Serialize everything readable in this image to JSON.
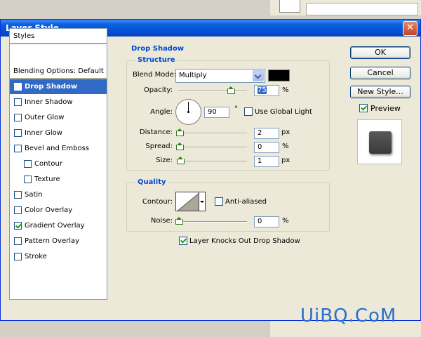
{
  "window": {
    "title": "Layer Style",
    "close_glyph": "✕"
  },
  "styles_list": {
    "header": "Styles",
    "items": [
      {
        "label": "Blending Options: Default",
        "checkbox": false,
        "checked": false,
        "selected": false,
        "indent": 0
      },
      {
        "label": "Drop Shadow",
        "checkbox": true,
        "checked": true,
        "selected": true,
        "indent": 0
      },
      {
        "label": "Inner Shadow",
        "checkbox": true,
        "checked": false,
        "selected": false,
        "indent": 0
      },
      {
        "label": "Outer Glow",
        "checkbox": true,
        "checked": false,
        "selected": false,
        "indent": 0
      },
      {
        "label": "Inner Glow",
        "checkbox": true,
        "checked": false,
        "selected": false,
        "indent": 0
      },
      {
        "label": "Bevel and Emboss",
        "checkbox": true,
        "checked": false,
        "selected": false,
        "indent": 0
      },
      {
        "label": "Contour",
        "checkbox": true,
        "checked": false,
        "selected": false,
        "indent": 1
      },
      {
        "label": "Texture",
        "checkbox": true,
        "checked": false,
        "selected": false,
        "indent": 1
      },
      {
        "label": "Satin",
        "checkbox": true,
        "checked": false,
        "selected": false,
        "indent": 0
      },
      {
        "label": "Color Overlay",
        "checkbox": true,
        "checked": false,
        "selected": false,
        "indent": 0
      },
      {
        "label": "Gradient Overlay",
        "checkbox": true,
        "checked": true,
        "selected": false,
        "indent": 0
      },
      {
        "label": "Pattern Overlay",
        "checkbox": true,
        "checked": false,
        "selected": false,
        "indent": 0
      },
      {
        "label": "Stroke",
        "checkbox": true,
        "checked": false,
        "selected": false,
        "indent": 0
      }
    ]
  },
  "drop_shadow": {
    "title": "Drop Shadow",
    "structure": {
      "title": "Structure",
      "blend_mode_label": "Blend Mode:",
      "blend_mode_value": "Multiply",
      "shadow_color": "#000000",
      "opacity_label": "Opacity:",
      "opacity_value": "75",
      "opacity_fraction": 0.75,
      "opacity_unit": "%",
      "angle_label": "Angle:",
      "angle_value": "90",
      "angle_unit": "°",
      "global_light_label": "Use Global Light",
      "global_light_checked": false,
      "distance_label": "Distance:",
      "distance_value": "2",
      "distance_unit": "px",
      "spread_label": "Spread:",
      "spread_value": "0",
      "spread_unit": "%",
      "size_label": "Size:",
      "size_value": "1",
      "size_unit": "px"
    },
    "quality": {
      "title": "Quality",
      "contour_label": "Contour:",
      "anti_aliased_label": "Anti-aliased",
      "anti_aliased_checked": false,
      "noise_label": "Noise:",
      "noise_value": "0",
      "noise_unit": "%"
    },
    "knockout_label": "Layer Knocks Out Drop Shadow",
    "knockout_checked": true
  },
  "buttons": {
    "ok": "OK",
    "cancel": "Cancel",
    "new_style": "New Style..."
  },
  "preview": {
    "label": "Preview",
    "checked": true
  },
  "watermark": "UiBQ.CoM",
  "colors": {
    "accent": "#316ac5",
    "title_blue": "#0046d5",
    "titlebar": "#0251d6"
  }
}
